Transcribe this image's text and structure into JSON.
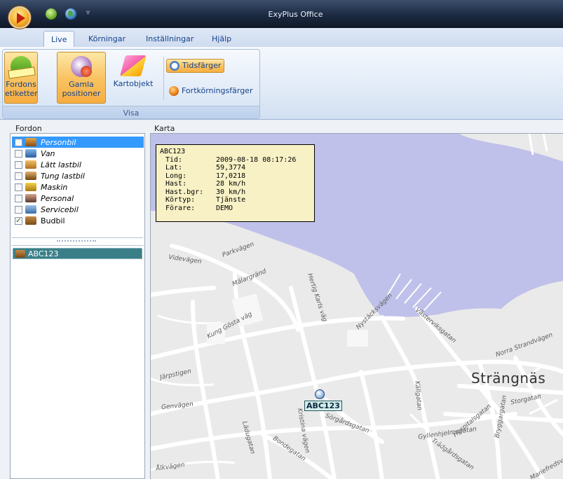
{
  "window": {
    "title": "ExyPlus Office"
  },
  "tabs": [
    {
      "label": "Live",
      "active": true
    },
    {
      "label": "Körningar",
      "active": false
    },
    {
      "label": "Inställningar",
      "active": false
    },
    {
      "label": "Hjälp",
      "active": false
    }
  ],
  "ribbon": {
    "group_label": "Visa",
    "fordons_etiketter": {
      "line1": "Fordons",
      "line2": "etiketter",
      "pressed": true
    },
    "gamla_positioner": {
      "line1": "Gamla",
      "line2": "positioner",
      "pressed": true
    },
    "kartobjekt": {
      "label": "Kartobjekt",
      "pressed": false
    },
    "tidsfarger": {
      "label": "Tidsfärger",
      "pressed": true
    },
    "fortkorningsfarger": {
      "label": "Fortkörningsfärger",
      "pressed": false
    }
  },
  "fordon": {
    "header": "Fordon",
    "types": [
      {
        "label": "Personbil",
        "checked": false,
        "selected": true
      },
      {
        "label": "Van",
        "checked": false
      },
      {
        "label": "Lätt lastbil",
        "checked": false
      },
      {
        "label": "Tung lastbil",
        "checked": false
      },
      {
        "label": "Maskin",
        "checked": false
      },
      {
        "label": "Personal",
        "checked": false
      },
      {
        "label": "Servicebil",
        "checked": false
      },
      {
        "label": "Budbil",
        "checked": true
      }
    ],
    "units": [
      {
        "label": "ABC123"
      }
    ]
  },
  "karta": {
    "header": "Karta",
    "town": "Strängnäs",
    "streets": [
      "Parkvägen",
      "Videvägen",
      "Mälargränd",
      "Kung Gösta väg",
      "Hertig Karls väg",
      "Nystäcksvägen",
      "Järpstigen",
      "Genvägen",
      "Kristina vägen",
      "Sörgårdsgatan",
      "Bondegatan",
      "Lädugatan",
      "Västerviksgatan",
      "Norra Strandvägen",
      "Storgatan",
      "Hospitalsgatan",
      "Gyllenhjelmsgatan",
      "Trädgårdsgatan",
      "Källgatan",
      "Bryggargatan",
      "Mariefredsvägen",
      "Ålkvägen"
    ],
    "marker_label": "ABC123",
    "tooltip": {
      "title": "ABC123",
      "rows": [
        {
          "key": "Tid:",
          "value": "2009-08-18 08:17:26"
        },
        {
          "key": "Lat:",
          "value": "59,3774"
        },
        {
          "key": "Long:",
          "value": "17,0218"
        },
        {
          "key": "Hast:",
          "value": "28 km/h"
        },
        {
          "key": "Hast.bgr:",
          "value": "30 km/h"
        },
        {
          "key": "Körtyp:",
          "value": "Tjänste"
        },
        {
          "key": "Förare:",
          "value": "DEMO"
        }
      ]
    }
  }
}
